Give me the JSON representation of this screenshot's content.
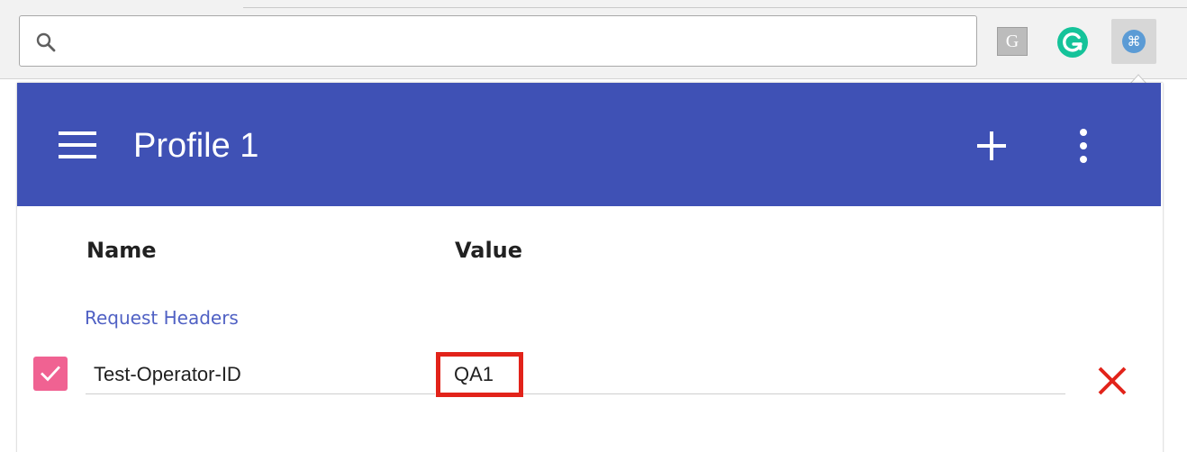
{
  "browser": {
    "omnibox": {
      "value": "",
      "icon": "search-icon"
    },
    "extensions": [
      {
        "name": "grey-g-extension",
        "glyph": "G",
        "color": "#bcbcbc"
      },
      {
        "name": "grammarly-extension",
        "icon": "grammarly-icon",
        "color": "#15c39a"
      },
      {
        "name": "modheader-extension",
        "glyph": "⌘",
        "color": "#5b9bd5"
      }
    ]
  },
  "popup": {
    "title": "Profile 1",
    "accent_color": "#3f51b5",
    "icons": {
      "menu": "hamburger-menu-icon",
      "add": "plus-icon",
      "more": "more-vertical-icon",
      "delete": "close-x-icon"
    },
    "columns": {
      "name": "Name",
      "value": "Value"
    },
    "section": "Request Headers",
    "rows": [
      {
        "enabled": true,
        "name": "Test-Operator-ID",
        "value": "QA1",
        "checkbox_color": "#f06292",
        "delete_color": "#e2231a"
      }
    ],
    "highlight_color": "#e2231a"
  }
}
